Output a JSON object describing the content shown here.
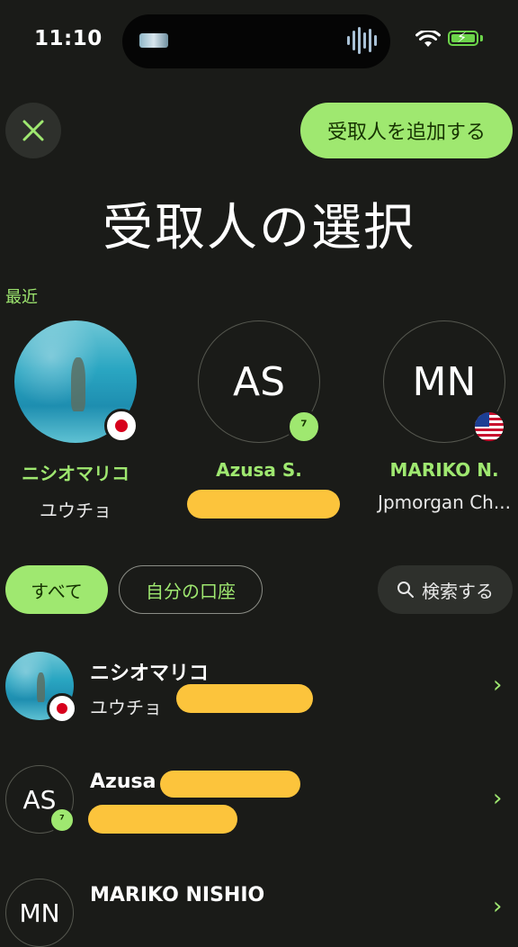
{
  "status_bar": {
    "time": "11:10"
  },
  "header": {
    "add_recipient_label": "受取人を追加する",
    "title": "受取人の選択"
  },
  "recent": {
    "label": "最近",
    "items": [
      {
        "initials": "",
        "name": "ニシオマリコ",
        "sub": "ユウチョ",
        "badge": "jp-flag-icon"
      },
      {
        "initials": "AS",
        "name": "Azusa S.",
        "sub": "",
        "badge": "wise-icon"
      },
      {
        "initials": "MN",
        "name": "MARIKO N.",
        "sub": "Jpmorgan Ch...",
        "badge": "us-flag-icon"
      }
    ]
  },
  "filters": {
    "all": "すべて",
    "own_accounts": "自分の口座",
    "search": "検索する"
  },
  "list": [
    {
      "initials": "",
      "name": "ニシオマリコ",
      "sub": "ユウチョ"
    },
    {
      "initials": "AS",
      "name": "Azusa",
      "sub": ""
    },
    {
      "initials": "MN",
      "name": "MARIKO NISHIO",
      "sub": ""
    }
  ],
  "colors": {
    "accent": "#9fe870",
    "background": "#1a1b18",
    "redaction": "#fcc43c"
  }
}
